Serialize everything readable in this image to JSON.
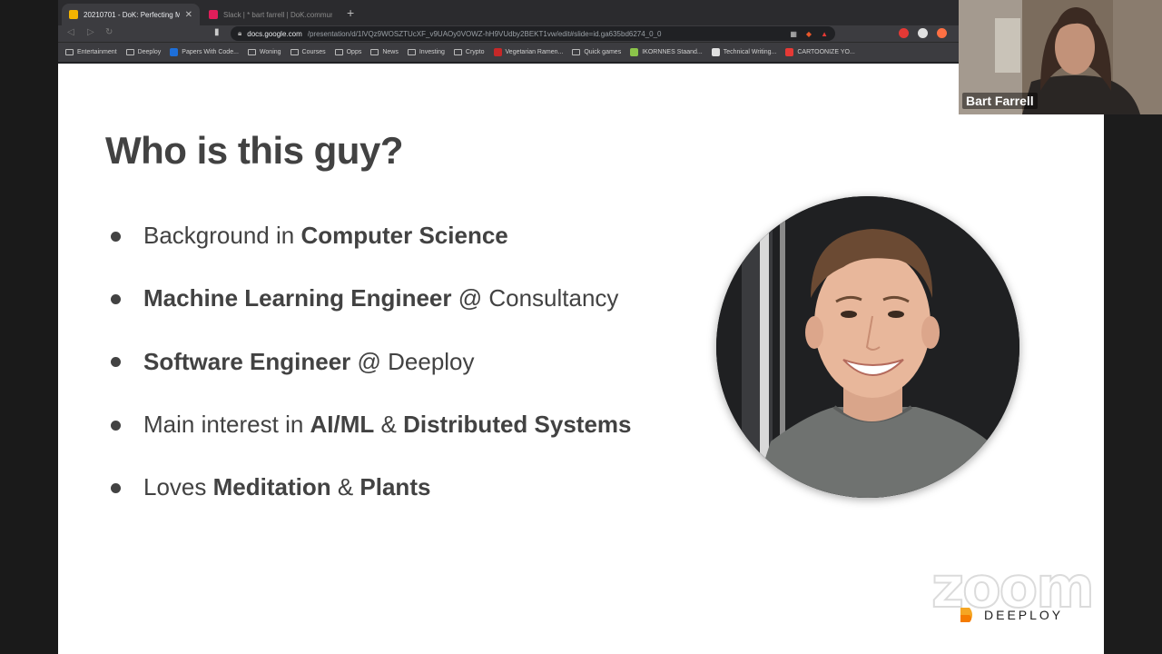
{
  "browser": {
    "tabs": [
      {
        "title": "20210701 - DoK: Perfecting M...",
        "favicon_color": "#f4b400",
        "active": true
      },
      {
        "title": "Slack | * bart farrell | DoK.community",
        "favicon_color": "#e01e5a",
        "active": false
      }
    ],
    "url_host": "docs.google.com",
    "url_path": "/presentation/d/1lVQz9WOSZTUcXF_v9UAOy0VOWZ-hH9VUdby2BEKT1vw/edit#slide=id.ga635bd6274_0_0",
    "bookmarks": [
      {
        "label": "Entertainment",
        "type": "folder"
      },
      {
        "label": "Deeploy",
        "type": "folder"
      },
      {
        "label": "Papers With Code...",
        "type": "site",
        "color": "#1e6fd9"
      },
      {
        "label": "Woning",
        "type": "folder"
      },
      {
        "label": "Courses",
        "type": "folder"
      },
      {
        "label": "Opps",
        "type": "folder"
      },
      {
        "label": "News",
        "type": "folder"
      },
      {
        "label": "Investing",
        "type": "folder"
      },
      {
        "label": "Crypto",
        "type": "folder"
      },
      {
        "label": "Vegetarian Ramen...",
        "type": "site",
        "color": "#c62828"
      },
      {
        "label": "Quick games",
        "type": "folder"
      },
      {
        "label": "IKORNNES Staand...",
        "type": "site",
        "color": "#8bc34a"
      },
      {
        "label": "Technical Writing...",
        "type": "site",
        "color": "#e0e0e0"
      },
      {
        "label": "CARTOONIZE YO...",
        "type": "site",
        "color": "#e53935"
      }
    ]
  },
  "slide": {
    "title": "Who is this guy?",
    "bullets": [
      [
        {
          "text": "Background in ",
          "bold": false
        },
        {
          "text": "Computer Science",
          "bold": true
        }
      ],
      [
        {
          "text": "Machine Learning Engineer",
          "bold": true
        },
        {
          "text": " @ Consultancy",
          "bold": false
        }
      ],
      [
        {
          "text": "Software Engineer",
          "bold": true
        },
        {
          "text": " @ Deeploy",
          "bold": false
        }
      ],
      [
        {
          "text": "Main interest in ",
          "bold": false
        },
        {
          "text": "AI/ML",
          "bold": true
        },
        {
          "text": " & ",
          "bold": false
        },
        {
          "text": "Distributed Systems",
          "bold": true
        }
      ],
      [
        {
          "text": "Loves ",
          "bold": false
        },
        {
          "text": "Meditation",
          "bold": true
        },
        {
          "text": " & ",
          "bold": false
        },
        {
          "text": "Plants",
          "bold": true
        }
      ]
    ],
    "zoom_watermark": "zoom",
    "brand": "DEEPLOY"
  },
  "video": {
    "participant_name": "Bart Farrell"
  },
  "colors": {
    "slide_text": "#424242",
    "slide_bg": "#ffffff",
    "brand_orange": "#f5a623",
    "chrome_bg": "#202124"
  }
}
